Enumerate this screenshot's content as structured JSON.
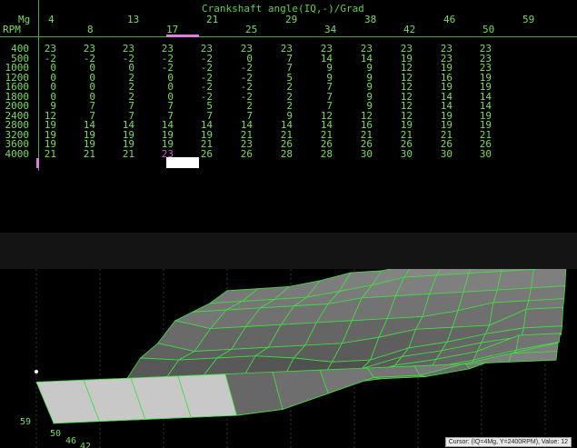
{
  "table": {
    "title": "Crankshaft angle(IQ,-)/Grad",
    "row_axis_label": "RPM",
    "col_axis_label": "Mg",
    "col_headers_upper": [
      "4",
      "13",
      "21",
      "29",
      "38",
      "46",
      "59"
    ],
    "col_headers_lower": [
      "8",
      "17",
      "25",
      "34",
      "42",
      "50"
    ],
    "rpm": [
      "400",
      "500",
      "1000",
      "1200",
      "1600",
      "1800",
      "2000",
      "2400",
      "2800",
      "3200",
      "3600",
      "4000"
    ],
    "rows": [
      [
        "23",
        "23",
        "23",
        "23",
        "23",
        "23",
        "23",
        "23",
        "23",
        "23",
        "23",
        "23"
      ],
      [
        "-2",
        "-2",
        "-2",
        "-2",
        "-2",
        "0",
        "7",
        "14",
        "14",
        "19",
        "23",
        "23"
      ],
      [
        "0",
        "0",
        "0",
        "-2",
        "-2",
        "-2",
        "7",
        "9",
        "9",
        "12",
        "19",
        "23"
      ],
      [
        "0",
        "0",
        "2",
        "0",
        "-2",
        "-2",
        "5",
        "9",
        "9",
        "12",
        "16",
        "19"
      ],
      [
        "0",
        "0",
        "2",
        "0",
        "-2",
        "-2",
        "2",
        "7",
        "9",
        "12",
        "19",
        "19"
      ],
      [
        "0",
        "0",
        "2",
        "0",
        "-2",
        "-2",
        "2",
        "7",
        "9",
        "12",
        "14",
        "14"
      ],
      [
        "9",
        "7",
        "7",
        "7",
        "5",
        "2",
        "2",
        "7",
        "9",
        "12",
        "14",
        "14"
      ],
      [
        "12",
        "7",
        "7",
        "7",
        "7",
        "7",
        "9",
        "12",
        "12",
        "12",
        "19",
        "19"
      ],
      [
        "19",
        "14",
        "14",
        "14",
        "14",
        "14",
        "14",
        "14",
        "16",
        "19",
        "19",
        "19"
      ],
      [
        "19",
        "19",
        "19",
        "19",
        "19",
        "21",
        "21",
        "21",
        "21",
        "21",
        "21",
        "21"
      ],
      [
        "19",
        "19",
        "19",
        "19",
        "21",
        "23",
        "26",
        "26",
        "26",
        "26",
        "26",
        "26"
      ],
      [
        "21",
        "21",
        "21",
        "23",
        "26",
        "26",
        "28",
        "28",
        "30",
        "30",
        "30",
        "30"
      ]
    ],
    "selected": {
      "row": 11,
      "col": 3
    }
  },
  "map3d": {
    "axis_labels": [
      "59",
      "50",
      "46",
      "42"
    ],
    "status_text": "Cursor: (IQ=4Mg, Y=2400RPM), Value: 12",
    "colors": {
      "surface": "#5a5a5a",
      "grid": "#3fe03f",
      "highlight": "#c8c8c8"
    }
  }
}
